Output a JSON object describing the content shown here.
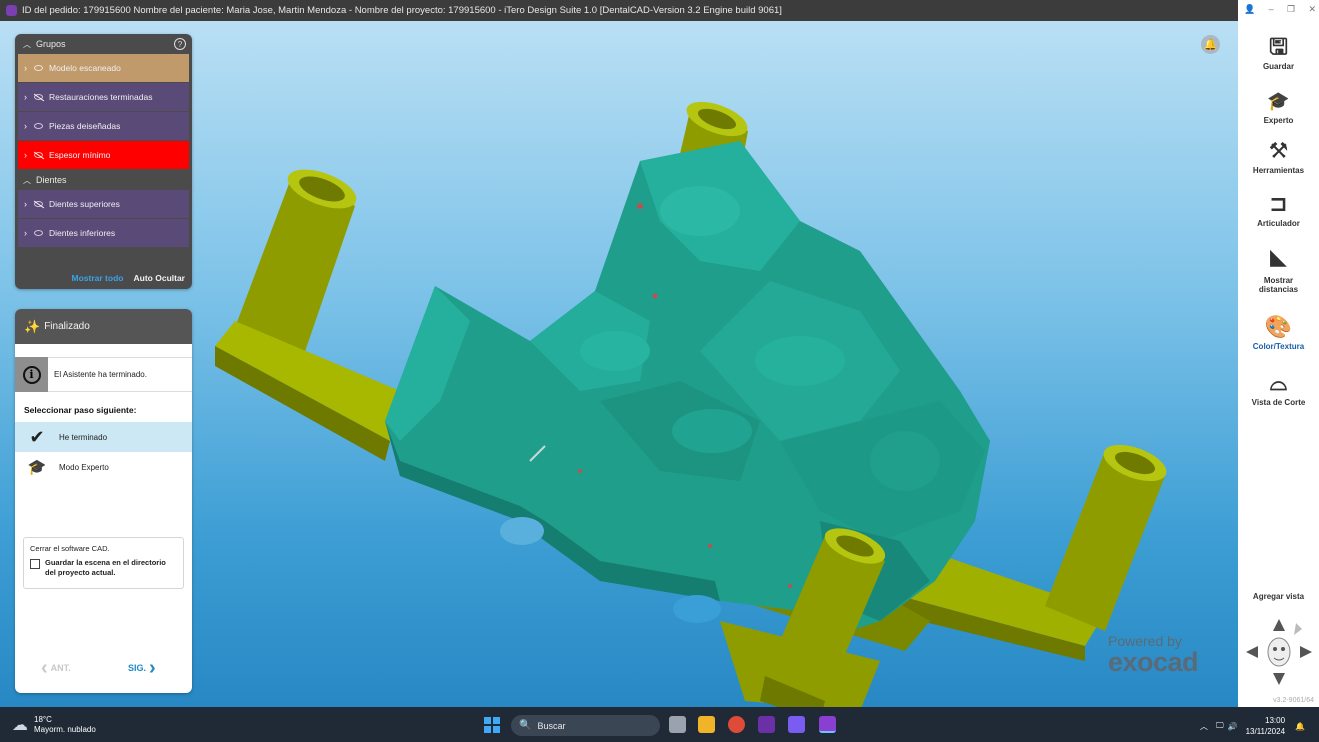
{
  "window": {
    "title": "ID del pedido: 179915600 Nombre del paciente: Maria Jose, Martin Mendoza - Nombre del proyecto: 179915600 - iTero Design Suite 1.0 [DentalCAD-Version 3.2 Engine build 9061]"
  },
  "groups_panel": {
    "section_groups": "Grupos",
    "items": [
      {
        "label": "Modelo escaneado",
        "color": "#c19a6b"
      },
      {
        "label": "Restauraciones terminadas",
        "color": "#5a4a78"
      },
      {
        "label": "Piezas deiseñadas",
        "color": "#5a4a78"
      },
      {
        "label": "Espesor mínimo",
        "color": "#ff0000"
      }
    ],
    "section_teeth": "Dientes",
    "teeth_items": [
      {
        "label": "Dientes superiores"
      },
      {
        "label": "Dientes inferiores"
      }
    ],
    "show_all": "Mostrar todo",
    "auto_hide": "Auto Ocultar"
  },
  "wizard": {
    "title": "Finalizado",
    "info": "El Asistente ha terminado.",
    "next_step_label": "Seleccionar paso siguiente:",
    "options": [
      {
        "label": "He terminado",
        "icon": "checkmark-icon"
      },
      {
        "label": "Modo Experto",
        "icon": "graduation-cap-icon"
      }
    ],
    "close_text": "Cerrar el software CAD.",
    "save_checkbox": "Guardar la escena en el directorio del proyecto actual.",
    "prev": "ANT.",
    "next": "SIG."
  },
  "toolbar": {
    "tools": [
      {
        "label": "Guardar",
        "icon": "save-icon"
      },
      {
        "label": "Experto",
        "icon": "graduation-cap-icon"
      },
      {
        "label": "Herramientas",
        "icon": "tools-icon"
      },
      {
        "label": "Articulador",
        "icon": "articulator-icon"
      },
      {
        "label": "Mostrar distancias",
        "icon": "distance-icon"
      },
      {
        "label": "Color/Textura",
        "icon": "palette-icon"
      },
      {
        "label": "Vista de Corte",
        "icon": "cut-view-icon"
      }
    ],
    "add_view": "Agregar vista",
    "version": "v3.2-9061/64"
  },
  "brand": {
    "powered_by": "Powered by",
    "name": "exocad"
  },
  "taskbar": {
    "weather_temp": "18°C",
    "weather_desc": "Mayorm. nublado",
    "search_placeholder": "Buscar",
    "time": "13:00",
    "date": "13/11/2024"
  },
  "colors": {
    "model": "#1fa38f",
    "base": "#a4b400",
    "accent": "#1f8ac7"
  }
}
